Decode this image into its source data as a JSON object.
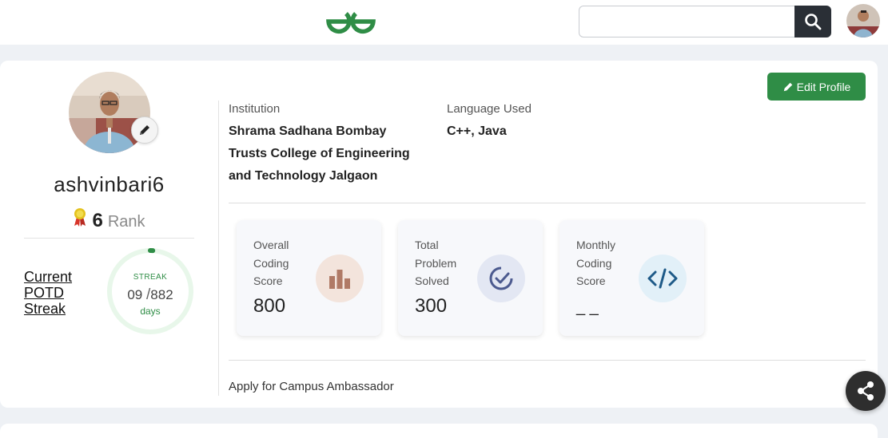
{
  "header": {
    "logo_icon": "geeksforgeeks-logo",
    "search": {
      "placeholder": "",
      "value": ""
    },
    "search_icon": "search-icon",
    "avatar_icon": "user-avatar"
  },
  "profile": {
    "username": "ashvinbari6",
    "rank_value": "6",
    "rank_label": "Rank",
    "rank_icon": "medal-icon",
    "edit_pic_icon": "pencil-icon",
    "potd_link": "Current POTD Streak",
    "streak": {
      "label": "STREAK",
      "current": "09",
      "separator": "/",
      "total": "882",
      "unit": "days",
      "progress_fraction": 0.01
    }
  },
  "actions": {
    "edit_profile_label": "Edit Profile",
    "edit_profile_icon": "pencil-icon"
  },
  "info": {
    "institution_label": "Institution",
    "institution_lines": [
      "Shrama Sadhana Bombay",
      "Trusts College of Engineering",
      "and Technology Jalgaon"
    ],
    "language_label": "Language Used",
    "language_value": "C++, Java"
  },
  "stats": [
    {
      "title": [
        "Overall",
        "Coding",
        "Score"
      ],
      "value": "800",
      "icon": "bar-chart-icon"
    },
    {
      "title": [
        "Total",
        "Problem",
        "Solved"
      ],
      "value": "300",
      "icon": "check-circle-icon"
    },
    {
      "title": [
        "Monthly",
        "Coding",
        "Score"
      ],
      "value": "_ _",
      "icon": "code-icon"
    }
  ],
  "footer": {
    "ambassador_link": "Apply for Campus Ambassador",
    "share_icon": "share-icon"
  },
  "colors": {
    "brand_green": "#2f8d46",
    "dark_button": "#2a2f36",
    "page_bg": "#eef1f5"
  }
}
